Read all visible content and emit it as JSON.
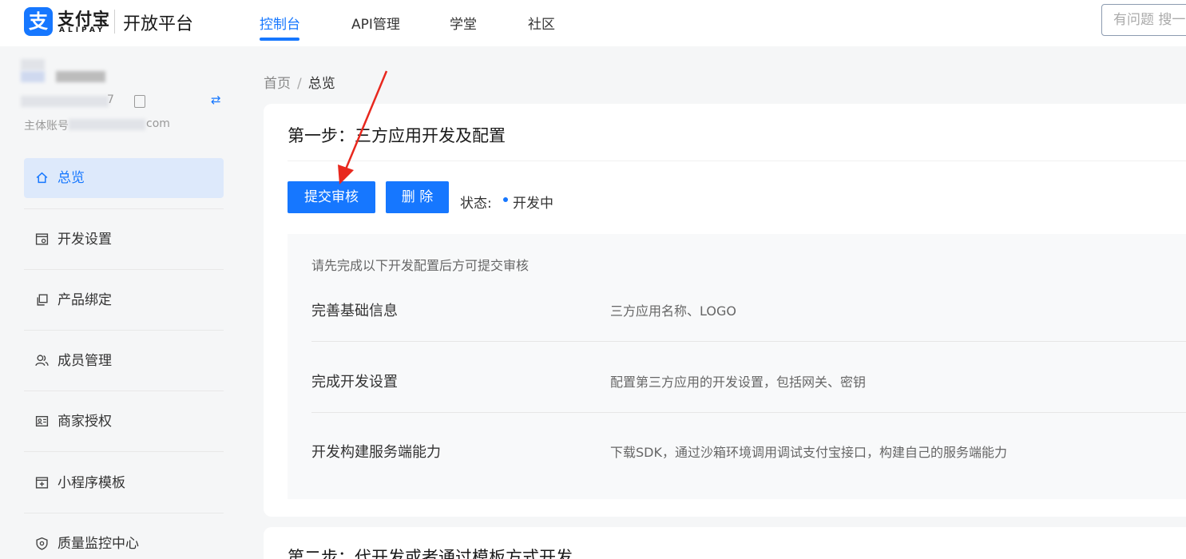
{
  "header": {
    "logo_mark": "支",
    "logo_name": "支付宝",
    "logo_sub": "ALIPAY",
    "platform": "开放平台",
    "nav": [
      {
        "label": "控制台",
        "active": true
      },
      {
        "label": "API管理",
        "active": false
      },
      {
        "label": "学堂",
        "active": false
      },
      {
        "label": "社区",
        "active": false
      }
    ],
    "search_placeholder": "有问题 搜一"
  },
  "sidebar": {
    "account_id_suffix": "7",
    "account_label_prefix": "主体账号",
    "account_email_suffix": "com",
    "items": [
      {
        "label": "总览",
        "icon": "home-icon",
        "active": true
      },
      {
        "label": "开发设置",
        "icon": "dev-settings-icon",
        "active": false
      },
      {
        "label": "产品绑定",
        "icon": "product-bind-icon",
        "active": false
      },
      {
        "label": "成员管理",
        "icon": "members-icon",
        "active": false
      },
      {
        "label": "商家授权",
        "icon": "merchant-auth-icon",
        "active": false
      },
      {
        "label": "小程序模板",
        "icon": "template-icon",
        "active": false
      },
      {
        "label": "质量监控中心",
        "icon": "quality-monitor-icon",
        "active": false
      }
    ]
  },
  "breadcrumb": {
    "home": "首页",
    "separator": "/",
    "current": "总览"
  },
  "step1": {
    "title": "第一步：三方应用开发及配置",
    "submit_button": "提交审核",
    "delete_button": "删 除",
    "status_label": "状态:",
    "status_value": "开发中",
    "hint": "请先完成以下开发配置后方可提交审核",
    "rows": [
      {
        "title": "完善基础信息",
        "desc": "三方应用名称、LOGO"
      },
      {
        "title": "完成开发设置",
        "desc": "配置第三方应用的开发设置，包括网关、密钥"
      },
      {
        "title": "开发构建服务端能力",
        "desc": "下载SDK，通过沙箱环境调用调试支付宝接口，构建自己的服务端能力"
      }
    ]
  },
  "step2": {
    "title": "第二步：代开发或者通过模板方式开发"
  },
  "colors": {
    "accent": "#1677ff",
    "annotation_arrow": "#e8281e"
  }
}
